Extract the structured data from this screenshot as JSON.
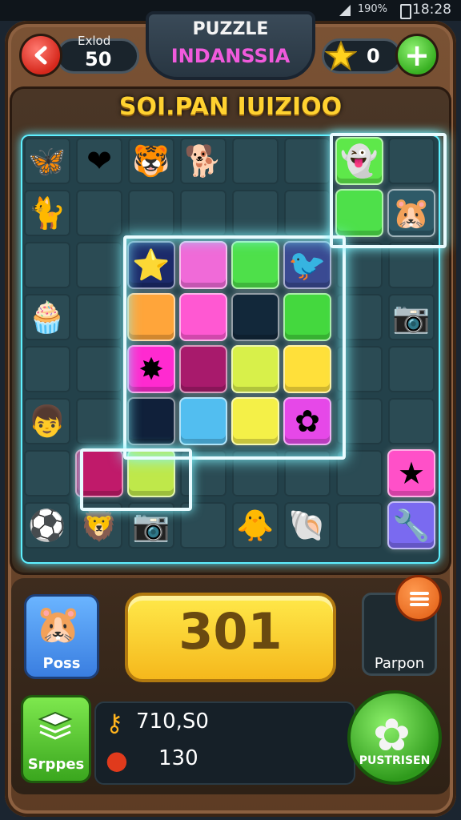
{
  "status_bar": {
    "network": "190%",
    "time": "18:28"
  },
  "header": {
    "moves_label": "Exlod",
    "moves_value": "50",
    "title_line1": "PUZZLE",
    "title_line2": "INDANSSIA",
    "stars_value": "0"
  },
  "level": {
    "subtitle": "SOI.PAN IUIZIOO"
  },
  "board": {
    "pieces": [
      {
        "row": 0,
        "col": 0,
        "glyph": "🦋",
        "name": "butterfly-piece"
      },
      {
        "row": 0,
        "col": 1,
        "glyph": "❤",
        "name": "heart-piece"
      },
      {
        "row": 0,
        "col": 2,
        "glyph": "🐯",
        "name": "tiger-piece"
      },
      {
        "row": 0,
        "col": 3,
        "glyph": "🐕",
        "name": "dog-piece"
      },
      {
        "row": 0,
        "col": 6,
        "glyph": "👻",
        "name": "ghost-piece"
      },
      {
        "row": 1,
        "col": 7,
        "glyph": "🐹",
        "name": "hamster-piece"
      },
      {
        "row": 1,
        "col": 0,
        "glyph": "🐈",
        "name": "cat-piece"
      },
      {
        "row": 2,
        "col": 2,
        "glyph": "⭐",
        "name": "star-piece"
      },
      {
        "row": 2,
        "col": 5,
        "glyph": "🐦",
        "name": "bird-piece"
      },
      {
        "row": 3,
        "col": 0,
        "glyph": "🧁",
        "name": "cup-piece"
      },
      {
        "row": 3,
        "col": 7,
        "glyph": "📷",
        "name": "camera-piece"
      },
      {
        "row": 4,
        "col": 2,
        "glyph": "✸",
        "name": "sun-piece"
      },
      {
        "row": 5,
        "col": 5,
        "glyph": "✿",
        "name": "flower-piece"
      },
      {
        "row": 5,
        "col": 0,
        "glyph": "👦",
        "name": "boy-piece"
      },
      {
        "row": 6,
        "col": 7,
        "glyph": "★",
        "name": "star-badge-piece"
      },
      {
        "row": 7,
        "col": 0,
        "glyph": "⚽",
        "name": "ball-piece"
      },
      {
        "row": 7,
        "col": 1,
        "glyph": "🦁",
        "name": "lion-piece"
      },
      {
        "row": 7,
        "col": 2,
        "glyph": "📷",
        "name": "camera2-piece"
      },
      {
        "row": 7,
        "col": 4,
        "glyph": "🐥",
        "name": "chick-piece"
      },
      {
        "row": 7,
        "col": 5,
        "glyph": "🐚",
        "name": "shell-piece"
      },
      {
        "row": 7,
        "col": 7,
        "glyph": "🔧",
        "name": "tool-piece"
      }
    ],
    "tiles": [
      {
        "row": 2,
        "col": 2,
        "color": "#1c2a6a"
      },
      {
        "row": 2,
        "col": 3,
        "color": "#f06ad8"
      },
      {
        "row": 2,
        "col": 4,
        "color": "#4ee04a"
      },
      {
        "row": 2,
        "col": 5,
        "color": "#3a4a92"
      },
      {
        "row": 3,
        "col": 2,
        "color": "#ffa53a"
      },
      {
        "row": 3,
        "col": 3,
        "color": "#ff58d2"
      },
      {
        "row": 3,
        "col": 4,
        "color": "#12283a"
      },
      {
        "row": 3,
        "col": 5,
        "color": "#44d83e"
      },
      {
        "row": 4,
        "col": 2,
        "color": "#ff2ad0"
      },
      {
        "row": 4,
        "col": 3,
        "color": "#a81a6c"
      },
      {
        "row": 4,
        "col": 4,
        "color": "#d8f04a"
      },
      {
        "row": 4,
        "col": 5,
        "color": "#ffe03a"
      },
      {
        "row": 5,
        "col": 2,
        "color": "#10203a"
      },
      {
        "row": 5,
        "col": 3,
        "color": "#52bef0"
      },
      {
        "row": 5,
        "col": 4,
        "color": "#f4f048"
      },
      {
        "row": 5,
        "col": 5,
        "color": "#e648e8"
      },
      {
        "row": 6,
        "col": 1,
        "color": "#c01a6a"
      },
      {
        "row": 6,
        "col": 2,
        "color": "#bfe84a"
      },
      {
        "row": 0,
        "col": 6,
        "color": "#5ee84a"
      },
      {
        "row": 1,
        "col": 6,
        "color": "#4ee04a"
      },
      {
        "row": 1,
        "col": 7,
        "color": "#2e5a68"
      },
      {
        "row": 6,
        "col": 7,
        "color": "#ff50c8"
      },
      {
        "row": 7,
        "col": 7,
        "color": "#7a6af0"
      }
    ]
  },
  "controls": {
    "pass_label": "Poss",
    "score": "301",
    "parpon_label": "Parpon",
    "sr_label": "Srppes",
    "settings_label": "PUSTRISEN"
  },
  "resources": {
    "keys": "710,S0",
    "apples": "130"
  },
  "colors": {
    "accent_yellow": "#ffd230",
    "glow": "#7ff6ff"
  }
}
